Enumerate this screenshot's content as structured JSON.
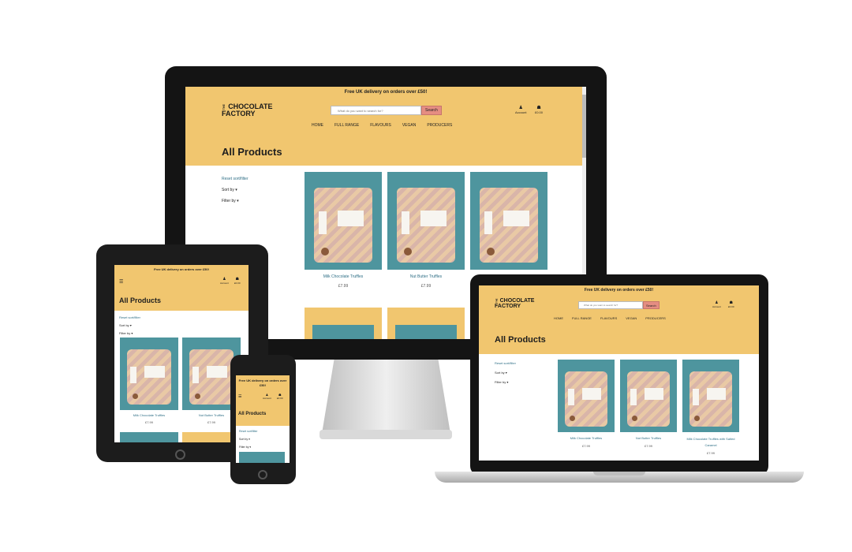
{
  "brand": {
    "the": "THE",
    "line1": "CHOCOLATE",
    "line2": "FACTORY"
  },
  "banner": "Free UK delivery on orders over £50!",
  "search": {
    "placeholder": "What do you want to search for?",
    "button": "Search"
  },
  "account": {
    "label": "Account",
    "icon": "user-icon"
  },
  "bag": {
    "label": "£0.00",
    "icon": "shopping-bag-icon"
  },
  "menu_icon": "hamburger-icon",
  "nav": [
    "HOME",
    "FULL RANGE",
    "FLAVOURS",
    "VEGAN",
    "PRODUCERS"
  ],
  "page_title": "All Products",
  "sidebar": {
    "reset": "Reset sort/filter",
    "sort": "Sort by",
    "filter": "Filter by"
  },
  "products": [
    {
      "name": "Milk Chocolate Truffles",
      "price": "£7.99"
    },
    {
      "name": "Nut Butter Truffles",
      "price": "£7.99"
    },
    {
      "name": "Milk Chocolate Truffles with Salted Caramel",
      "price": "£7.99"
    }
  ],
  "colors": {
    "accent": "#f1c66f",
    "card_bg": "#4e959e",
    "search_button": "#e58d82",
    "link": "#2f6f86"
  }
}
